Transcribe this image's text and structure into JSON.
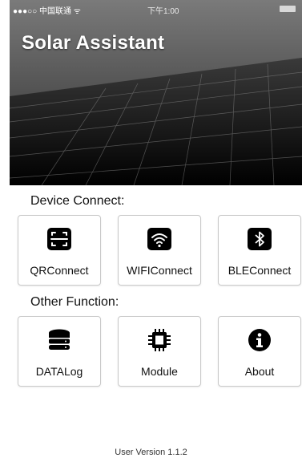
{
  "status_bar": {
    "carrier": "●●●○○ 中国联通 ᯤ",
    "time": "下午1:00"
  },
  "app": {
    "title": "Solar Assistant"
  },
  "device_connect": {
    "title": "Device Connect:",
    "items": [
      {
        "label": "QRConnect",
        "icon": "qr-scan-icon"
      },
      {
        "label": "WIFIConnect",
        "icon": "wifi-icon"
      },
      {
        "label": "BLEConnect",
        "icon": "bluetooth-icon"
      }
    ]
  },
  "other_function": {
    "title": "Other Function:",
    "items": [
      {
        "label": "DATALog",
        "icon": "database-icon"
      },
      {
        "label": "Module",
        "icon": "chip-icon"
      },
      {
        "label": "About",
        "icon": "info-icon"
      }
    ]
  },
  "footer": {
    "version": "User Version 1.1.2"
  }
}
